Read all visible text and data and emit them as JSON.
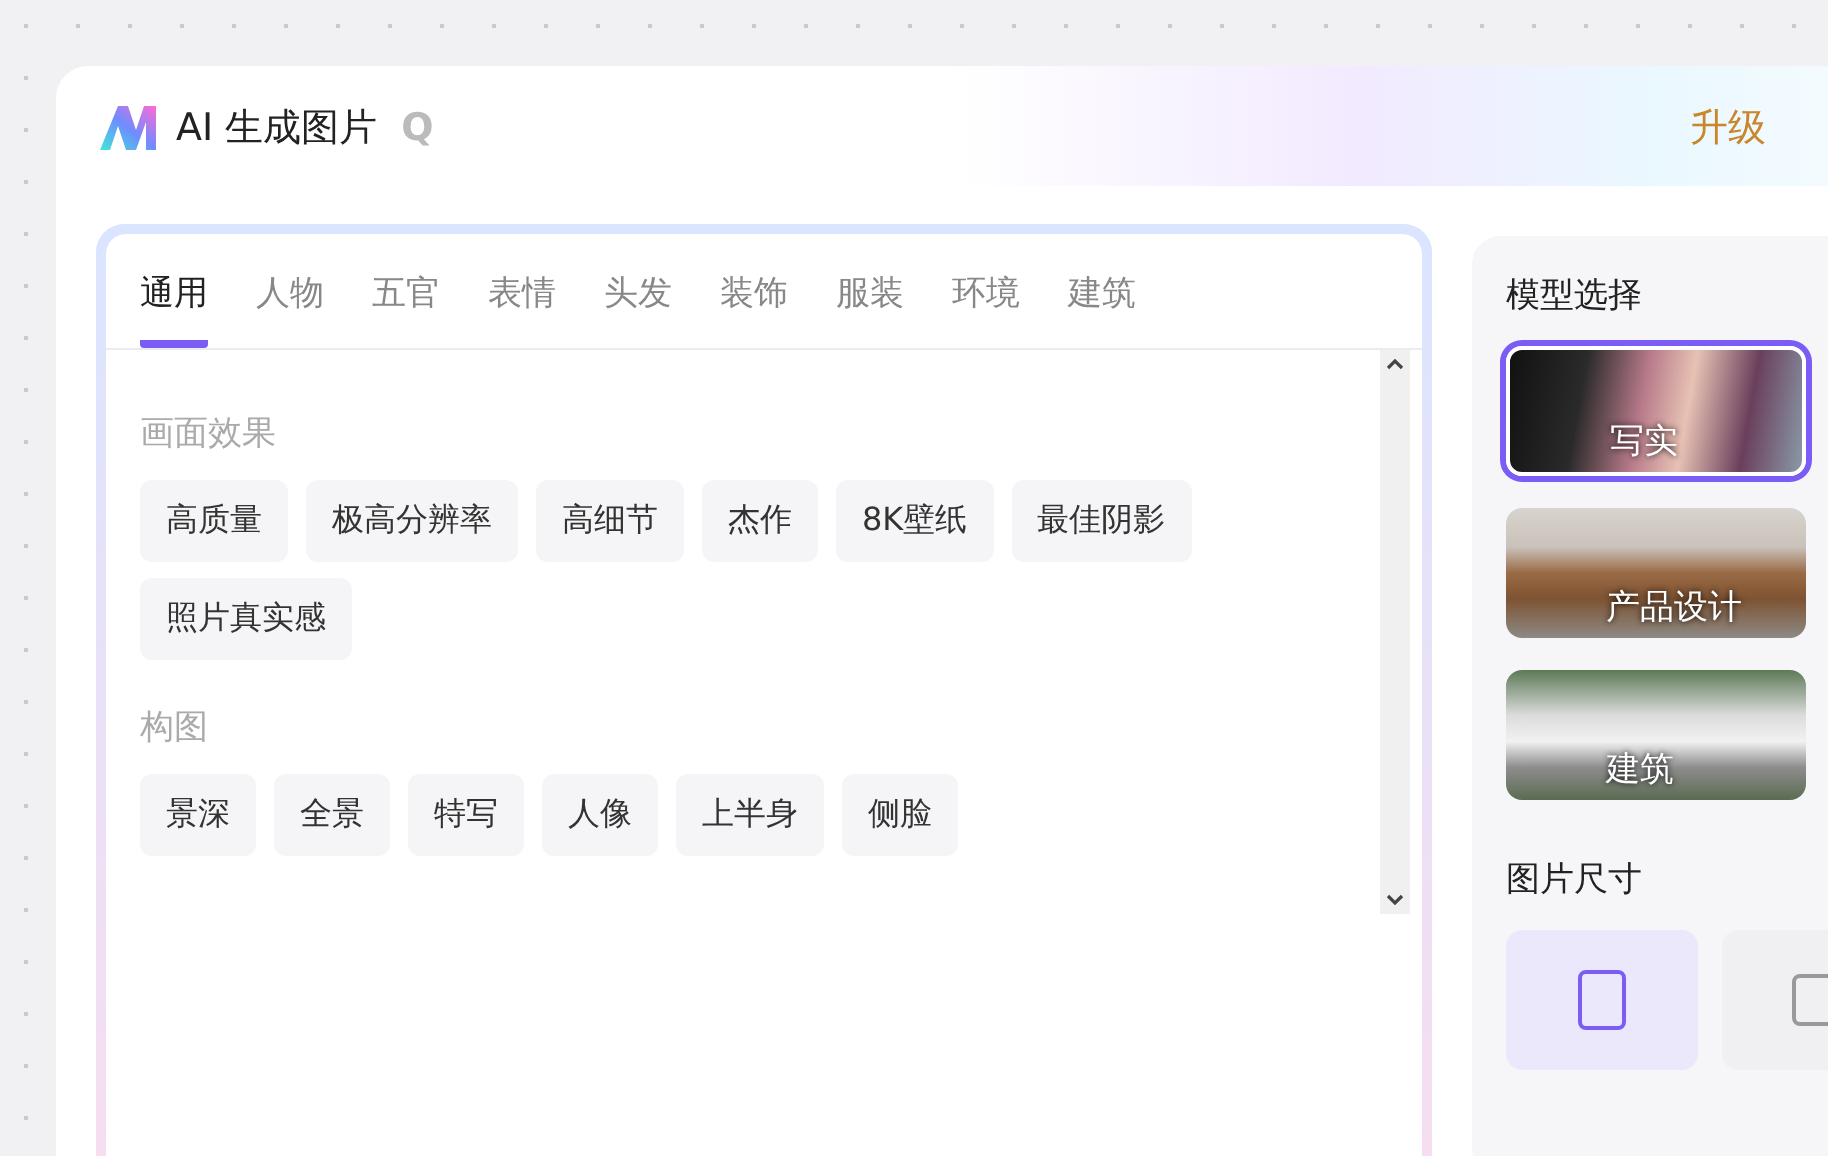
{
  "header": {
    "title": "AI 生成图片",
    "search_hint": "Q",
    "upgrade": "升级"
  },
  "tabs": [
    {
      "label": "通用",
      "selected": true
    },
    {
      "label": "人物",
      "selected": false
    },
    {
      "label": "五官",
      "selected": false
    },
    {
      "label": "表情",
      "selected": false
    },
    {
      "label": "头发",
      "selected": false
    },
    {
      "label": "装饰",
      "selected": false
    },
    {
      "label": "服装",
      "selected": false
    },
    {
      "label": "环境",
      "selected": false
    },
    {
      "label": "建筑",
      "selected": false
    }
  ],
  "tag_groups": [
    {
      "title": "画面效果",
      "tags": [
        "高质量",
        "极高分辨率",
        "高细节",
        "杰作",
        "8K壁纸",
        "最佳阴影",
        "照片真实感"
      ]
    },
    {
      "title": "构图",
      "tags": [
        "景深",
        "全景",
        "特写",
        "人像",
        "上半身",
        "侧脸"
      ]
    }
  ],
  "model_section": {
    "title": "模型选择",
    "models": [
      {
        "label": "写实",
        "kind": "portrait",
        "selected": true
      },
      {
        "label": "产品设计",
        "kind": "sofa",
        "selected": false
      },
      {
        "label": "建筑",
        "kind": "house",
        "selected": false
      }
    ]
  },
  "size_section": {
    "title": "图片尺寸",
    "sizes": [
      {
        "kind": "portrait",
        "selected": true
      },
      {
        "kind": "square",
        "selected": false
      }
    ]
  }
}
